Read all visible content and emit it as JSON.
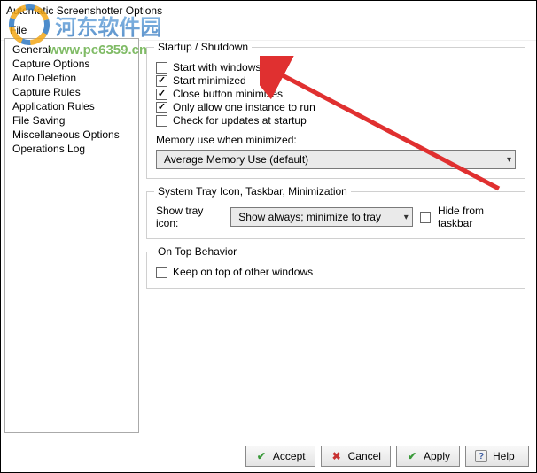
{
  "window": {
    "title": "Automatic Screenshotter Options"
  },
  "menu": {
    "file": "File",
    "file_key": "F"
  },
  "watermark": {
    "text": "河东软件园",
    "url": "www.pc6359.cn"
  },
  "sidebar": {
    "items": [
      {
        "label": "General"
      },
      {
        "label": "Capture Options"
      },
      {
        "label": "Auto Deletion"
      },
      {
        "label": "Capture Rules"
      },
      {
        "label": "Application Rules"
      },
      {
        "label": "File Saving"
      },
      {
        "label": "Miscellaneous Options"
      },
      {
        "label": "Operations Log"
      }
    ],
    "selected": 0
  },
  "groups": {
    "startup": {
      "legend": "Startup / Shutdown",
      "opts": [
        {
          "label": "Start with windows",
          "checked": false
        },
        {
          "label": "Start minimized",
          "checked": true
        },
        {
          "label": "Close button minimizes",
          "checked": true
        },
        {
          "label": "Only allow one instance to run",
          "checked": true
        },
        {
          "label": "Check for updates at startup",
          "checked": false
        }
      ],
      "memory_label": "Memory use when minimized:",
      "memory_value": "Average Memory Use (default)"
    },
    "tray": {
      "legend": "System Tray Icon, Taskbar, Minimization",
      "show_tray_label": "Show tray icon:",
      "show_tray_value": "Show always; minimize to tray",
      "hide_taskbar": {
        "label": "Hide from taskbar",
        "checked": false
      }
    },
    "ontop": {
      "legend": "On Top Behavior",
      "keep_on_top": {
        "label": "Keep on top of other windows",
        "checked": false
      }
    }
  },
  "buttons": {
    "accept": "Accept",
    "cancel": "Cancel",
    "apply": "Apply",
    "help": "Help"
  }
}
